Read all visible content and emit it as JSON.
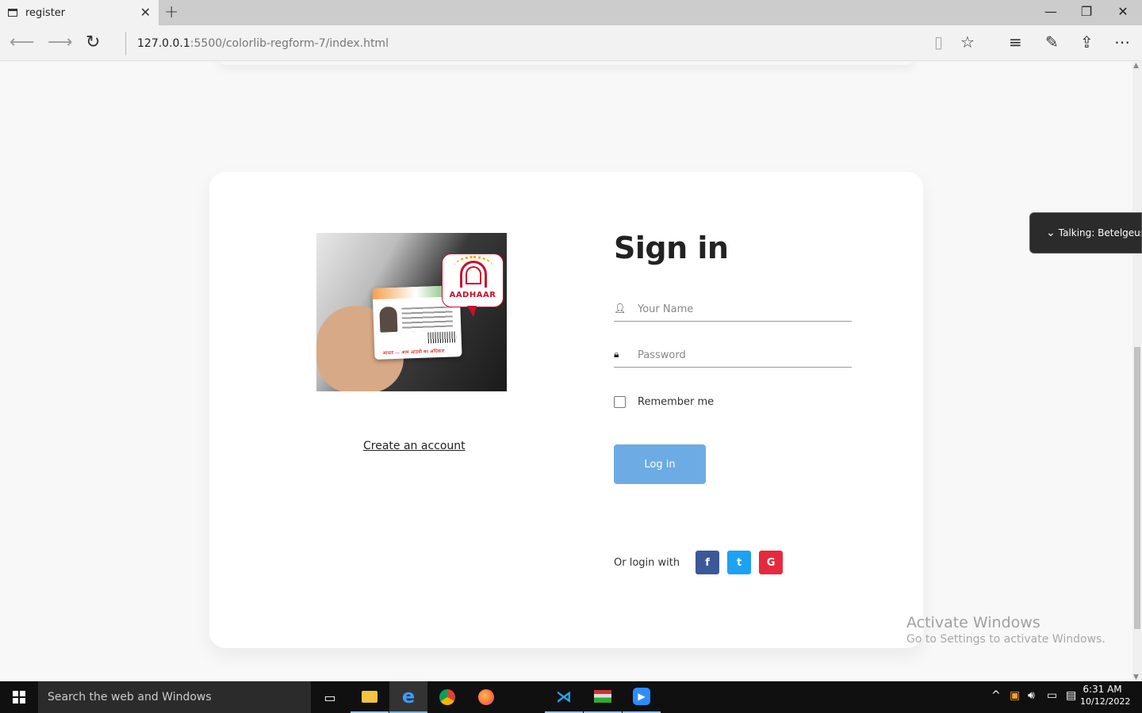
{
  "browser": {
    "tab_title": "register",
    "url_host": "127.0.0.1",
    "url_path": ":5500/colorlib-regform-7/index.html"
  },
  "card": {
    "hero_badge": "AADHAAR",
    "card_footer_text": "आधार — आम आदमी का अधिकार",
    "create_account_link": "Create an account",
    "title": "Sign in",
    "name_placeholder": "Your Name",
    "password_placeholder": "Password",
    "remember_label": "Remember me",
    "login_button": "Log in",
    "social_label": "Or login with",
    "social_buttons": [
      {
        "label": "f",
        "color": "#3b5998"
      },
      {
        "label": "t",
        "color": "#1da1f2"
      },
      {
        "label": "G",
        "color": "#e62a3d"
      }
    ],
    "accent_color": "#6dabe4"
  },
  "watermark": {
    "title": "Activate Windows",
    "subtitle": "Go to Settings to activate Windows."
  },
  "toast": {
    "text": "Talking: Betelgeuse"
  },
  "taskbar": {
    "search_placeholder": "Search the web and Windows",
    "time": "6:31 AM",
    "date": "10/12/2022"
  }
}
